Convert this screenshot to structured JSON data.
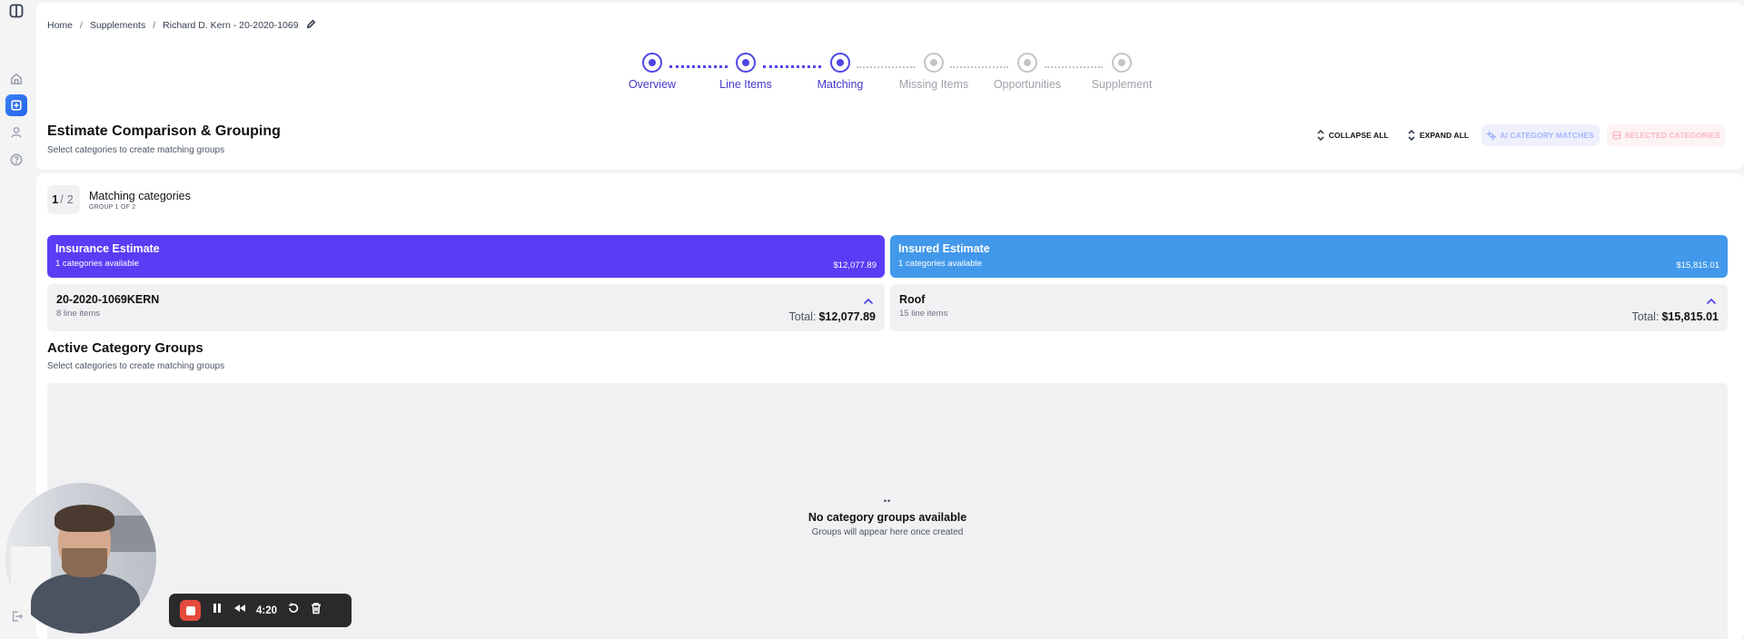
{
  "sidebar": {
    "items": [
      {
        "icon": "sidebar-toggle-icon"
      },
      {
        "icon": "home-icon"
      },
      {
        "icon": "add-document-icon",
        "active": true
      },
      {
        "icon": "user-icon"
      },
      {
        "icon": "help-icon"
      },
      {
        "icon": "logout-icon"
      }
    ]
  },
  "breadcrumb": {
    "home": "Home",
    "sep1": "/",
    "supplements": "Supplements",
    "sep2": "/",
    "current": "Richard D. Kern - 20-2020-1069"
  },
  "stepper": {
    "steps": [
      {
        "label": "Overview",
        "state": "complete"
      },
      {
        "label": "Line Items",
        "state": "complete"
      },
      {
        "label": "Matching",
        "state": "current"
      },
      {
        "label": "Missing Items",
        "state": "inactive"
      },
      {
        "label": "Opportunities",
        "state": "inactive"
      },
      {
        "label": "Supplement",
        "state": "inactive"
      }
    ]
  },
  "header": {
    "title": "Estimate Comparison & Grouping",
    "subtitle": "Select categories to create matching groups"
  },
  "actions": {
    "collapse_all": "COLLAPSE ALL",
    "expand_all": "EXPAND ALL",
    "ai_matches": "AI CATEGORY MATCHES",
    "selected": "SELECTED CATEGORIES"
  },
  "matching": {
    "counter_current": "1",
    "counter_sep": "/",
    "counter_total": "2",
    "title": "Matching categories",
    "subtitle": "GROUP 1 OF 2"
  },
  "insurance": {
    "title": "Insurance Estimate",
    "available": "1 categories available",
    "amount": "$12,077.89",
    "category": {
      "name": "20-2020-1069KERN",
      "count": "8 line items",
      "total_label": "Total:",
      "total_value": "$12,077.89"
    }
  },
  "insured": {
    "title": "Insured Estimate",
    "available": "1 categories available",
    "amount": "$15,815.01",
    "category": {
      "name": "Roof",
      "count": "15 line items",
      "total_label": "Total:",
      "total_value": "$15,815.01"
    }
  },
  "groups": {
    "title": "Active Category Groups",
    "subtitle": "Select categories to create matching groups",
    "empty_icon": "••",
    "empty_title": "No category groups available",
    "empty_subtitle": "Groups will appear here once created"
  },
  "recorder": {
    "time": "4:20"
  },
  "colors": {
    "primary": "#4f46e5",
    "insurance": "#5b3cf5",
    "insured": "#4298ea",
    "record": "#e54b3c"
  }
}
